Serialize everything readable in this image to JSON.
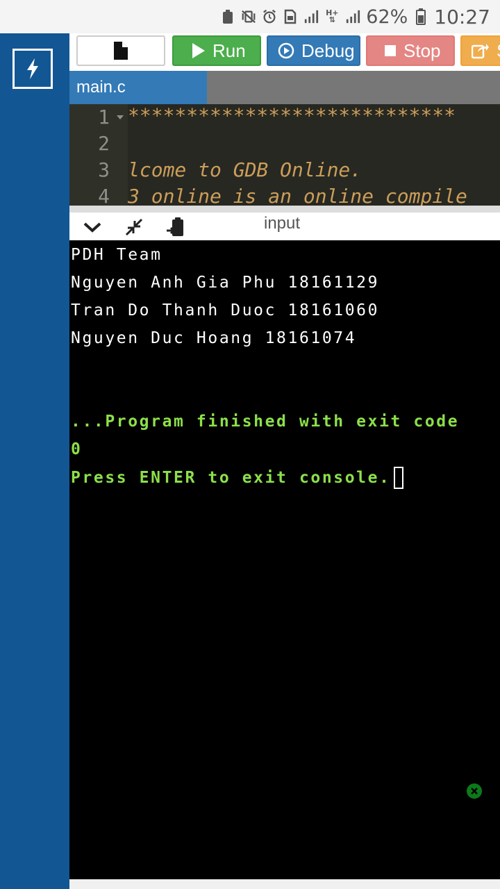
{
  "status_bar": {
    "battery_percent": "62%",
    "time": "10:27",
    "network": "H+"
  },
  "toolbar": {
    "run_label": "Run",
    "debug_label": "Debug",
    "stop_label": "Stop",
    "share_label": "S"
  },
  "tabs": [
    {
      "label": "main.c"
    }
  ],
  "editor": {
    "line_numbers": [
      "1",
      "2",
      "3",
      "4"
    ],
    "lines": [
      "****************************",
      "",
      "lcome to GDB Online.",
      "3 online is an online compile"
    ]
  },
  "console": {
    "title": "input",
    "output_lines": [
      "PDH Team",
      "Nguyen Anh Gia Phu 18161129",
      "Tran Do Thanh Duoc 18161060",
      "Nguyen Duc Hoang 18161074"
    ],
    "finish_line_1": "...Program finished with exit code",
    "finish_line_2": "0",
    "press_enter": "Press ENTER to exit console."
  },
  "colors": {
    "sidebar": "#135694",
    "run": "#4cae4c",
    "debug": "#337ab7",
    "stop": "#d9534f",
    "share": "#f0ad4e",
    "console_text": "#8ce04a"
  }
}
